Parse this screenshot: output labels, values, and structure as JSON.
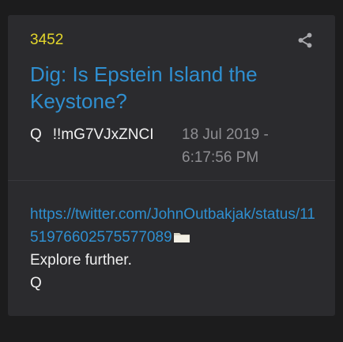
{
  "post": {
    "number": "3452",
    "title": "Dig: Is Epstein Island the Keystone?",
    "author": "Q",
    "tripcode": "!!mG7VJxZNCI",
    "timestamp": "18 Jul 2019 - 6:17:56 PM",
    "link": "https://twitter.com/JohnOutbakjak/status/1151976602575577089",
    "body_lines": [
      "Explore further.",
      "Q"
    ]
  },
  "icons": {
    "share": "share-icon",
    "folder": "folder-icon"
  },
  "colors": {
    "background": "#1c1c1d",
    "card": "#2b2b2e",
    "post_number": "#e3d62c",
    "link": "#2f8fd0",
    "timestamp": "#8e8e92",
    "text": "#f0f0f0"
  }
}
